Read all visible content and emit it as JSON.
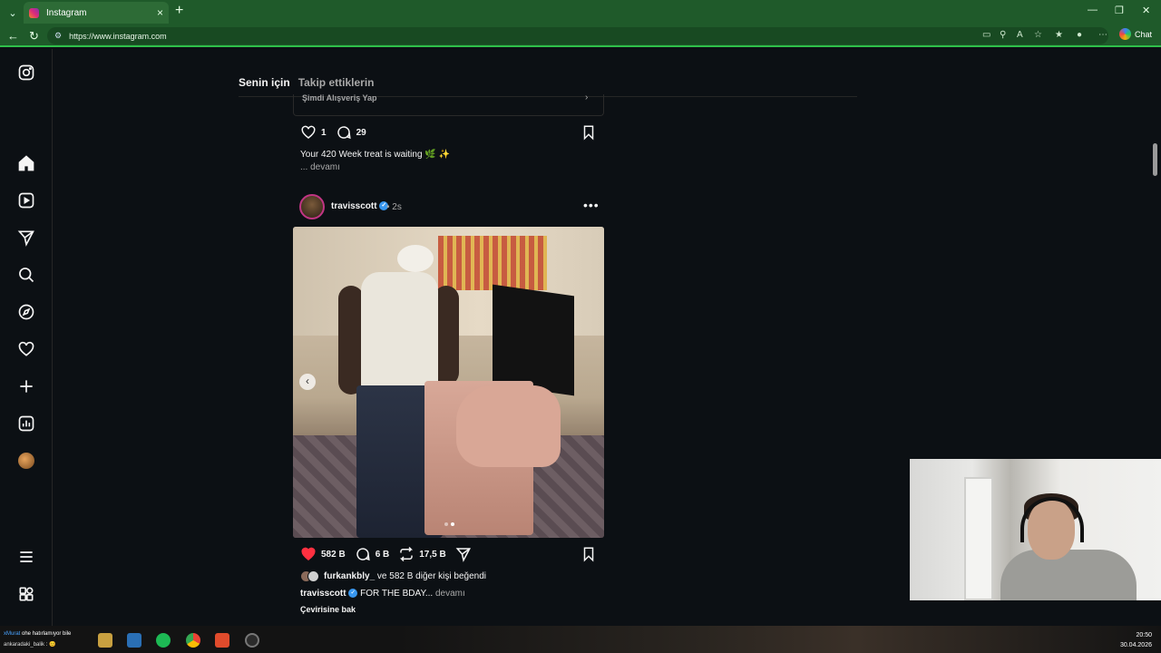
{
  "browser": {
    "tab_title": "Instagram",
    "url": "https://www.instagram.com",
    "chat_label": "Chat",
    "new_tab": "+",
    "tab_close": "×"
  },
  "feed": {
    "tabs": [
      {
        "label": "Senin için",
        "active": true
      },
      {
        "label": "Takip ettiklerin",
        "active": false
      }
    ]
  },
  "previous_post": {
    "shop_label": "Şimdi Alışveriş Yap",
    "like_count": "1",
    "comment_count": "29",
    "caption": "Your 420 Week treat is waiting 🌿 ✨",
    "more_label": "... devamı"
  },
  "post": {
    "username": "travisscott",
    "verified": true,
    "time": "• 2s",
    "like_count": "582 B",
    "comment_count": "6 B",
    "repost_count": "17,5 B",
    "liked_by_user": "furkankbly_",
    "liked_by_rest": " ve 582 B diğer kişi beğendi",
    "caption_user": "travisscott",
    "caption_text": "FOR THE BDAY...",
    "caption_more": "devamı",
    "translate_label": "Çevirisine bak",
    "carousel_total": 2,
    "carousel_active": 2
  },
  "sidebar": {
    "items": [
      {
        "name": "instagram-logo-icon"
      },
      {
        "name": "home-icon"
      },
      {
        "name": "reels-icon"
      },
      {
        "name": "messages-icon"
      },
      {
        "name": "search-icon"
      },
      {
        "name": "explore-icon"
      },
      {
        "name": "notifications-icon"
      },
      {
        "name": "create-icon"
      },
      {
        "name": "dashboard-icon"
      },
      {
        "name": "profile-avatar"
      },
      {
        "name": "menu-icon"
      },
      {
        "name": "also-from-meta-icon"
      }
    ]
  },
  "taskbar": {
    "chat_line1_user": "xMurat",
    "chat_line1_text": " ohe hatırlamıyor bile",
    "chat_line2_user": "ankaradaki_balik",
    "chat_line2_text": " : 😊",
    "time": "20:50",
    "date": "30.04.2026"
  },
  "colors": {
    "browser_chrome": "#1f5a2a",
    "page_bg": "#0c1014",
    "like_red": "#ff3040",
    "verified_blue": "#3897f0"
  }
}
